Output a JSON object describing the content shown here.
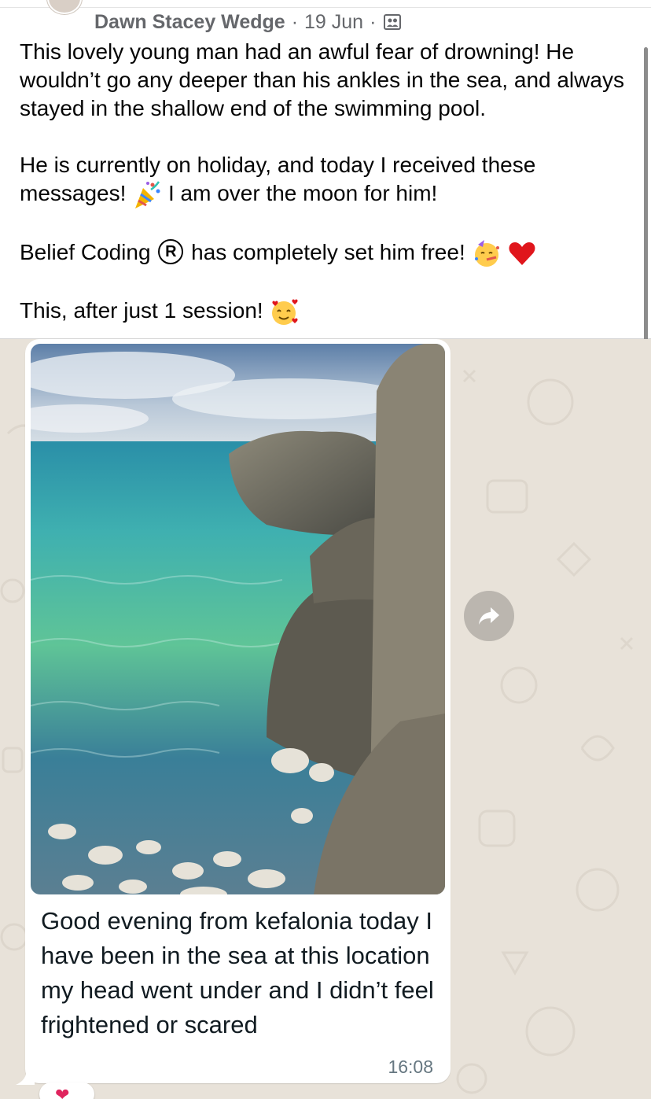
{
  "post": {
    "author": "Dawn Stacey Wedge",
    "separator": "·",
    "date": "19 Jun",
    "audience_icon": "friends-group-icon",
    "paragraphs": [
      "This lovely young man had an awful fear of drowning! He wouldn’t go any deeper than his ankles in the sea, and always stayed in the shallow end of the swimming pool.",
      "He is currently on holiday, and today I received these messages!",
      "I am over the moon for him!",
      "Belief Coding",
      "has completely set him free!",
      "This, after just 1 session!"
    ],
    "registered_mark": "R"
  },
  "message": {
    "photo_icon": "sea-rocks-photo",
    "caption": "Good evening from kefalonia today I have been in the sea at this location my head went under and I didn’t feel frightened or scared",
    "time": "16:08",
    "reaction": "❤"
  },
  "colors": {
    "text": "#050505",
    "meta": "#65676b",
    "chat_bg": "#e8e2d9",
    "bubble": "#ffffff",
    "time": "#667781"
  }
}
